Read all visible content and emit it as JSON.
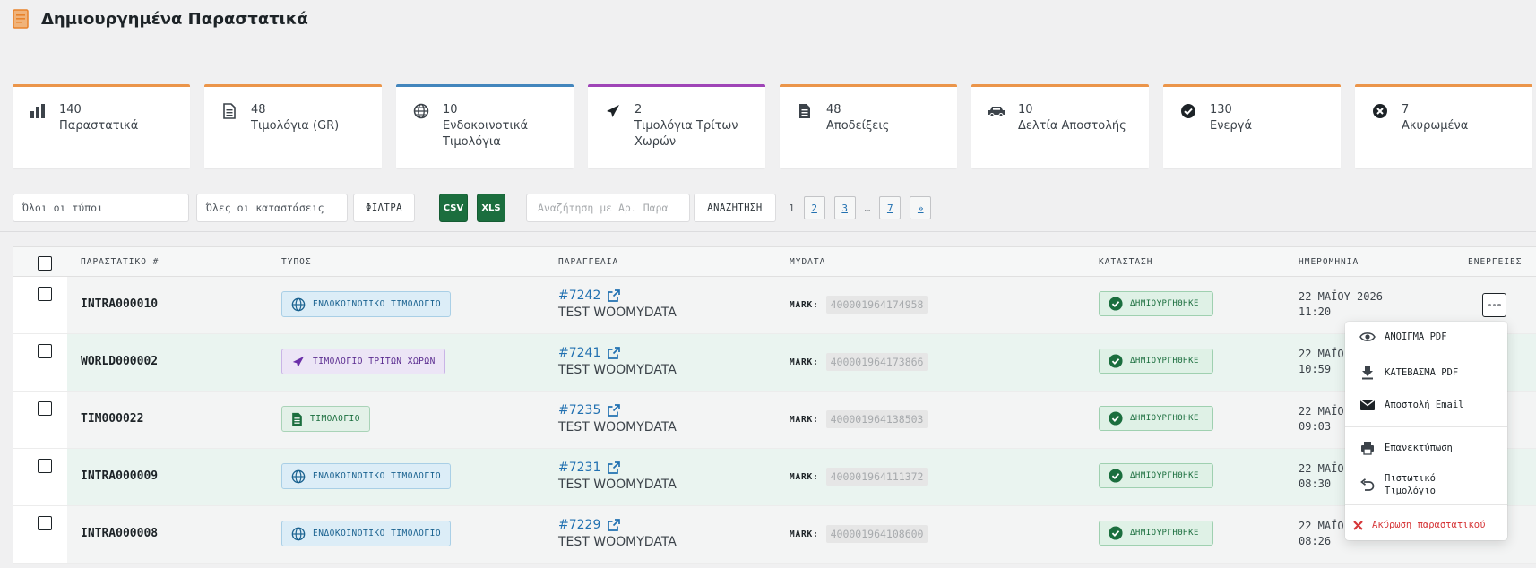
{
  "header": {
    "title": "Δημιουργημένα Παραστατικά",
    "icon": "document-icon"
  },
  "stats": [
    {
      "value": "140",
      "label": "Παραστατικά",
      "icon": "bar-chart-icon",
      "accent": "#e8822a"
    },
    {
      "value": "48",
      "label": "Τιμολόγια (GR)",
      "icon": "document-icon",
      "accent": "#e8822a"
    },
    {
      "value": "10",
      "label": "Ενδοκοινοτικά Τιμολόγια",
      "icon": "globe-icon",
      "accent": "#2271b1"
    },
    {
      "value": "2",
      "label": "Τιμολόγια Τρίτων Χωρών",
      "icon": "airplane-icon",
      "accent": "#8e24aa"
    },
    {
      "value": "48",
      "label": "Αποδείξεις",
      "icon": "receipt-icon",
      "accent": "#e8822a"
    },
    {
      "value": "10",
      "label": "Δελτία Αποστολής",
      "icon": "truck-icon",
      "accent": "#e8822a"
    },
    {
      "value": "130",
      "label": "Ενεργά",
      "icon": "check-circle-icon",
      "accent": "#e8822a"
    },
    {
      "value": "7",
      "label": "Ακυρωμένα",
      "icon": "x-circle-icon",
      "accent": "#e8822a"
    }
  ],
  "toolbar": {
    "type_filter": "Όλοι οι τύποι",
    "status_filter": "Όλες οι καταστάσεις",
    "filter_button": "ΦΙΛΤΡΑ",
    "csv_button": "CSV",
    "xls_button": "XLS",
    "search_placeholder": "Αναζήτηση με Αρ. Παρα",
    "search_button": "ΑΝΑΖΗΤΗΣΗ"
  },
  "pagination": {
    "current": "1",
    "pages": [
      "2",
      "3"
    ],
    "ellipsis": "…",
    "last": "7",
    "next": "»"
  },
  "table": {
    "columns": [
      "ΠΑΡΑΣΤΑΤΙΚΟ #",
      "ΤΥΠΟΣ",
      "ΠΑΡΑΓΓΕΛΙΑ",
      "MYDATA",
      "ΚΑΤΑΣΤΑΣΗ",
      "ΗΜΕΡΟΜΗΝΙΑ",
      "ΕΝΕΡΓΕΙΕΣ"
    ],
    "mark_label": "MARK:",
    "rows": [
      {
        "id": "INTRA000010",
        "type": "ΕΝΔΟΚΟΙΝΟΤΙΚΟ ΤΙΜΟΛΟΓΙΟ",
        "type_kind": "intra",
        "order": "#7242",
        "customer": "TEST WOOMYDATA",
        "mark": "400001964174958",
        "status": "ΔΗΜΙΟΥΡΓΗΘΗΚΕ",
        "date": "22 ΜΑΪΟΥ 2026",
        "time": "11:20"
      },
      {
        "id": "WORLD000002",
        "type": "ΤΙΜΟΛΟΓΙΟ ΤΡΙΤΩΝ ΧΩΡΩΝ",
        "type_kind": "world",
        "order": "#7241",
        "customer": "TEST WOOMYDATA",
        "mark": "400001964173866",
        "status": "ΔΗΜΙΟΥΡΓΗΘΗΚΕ",
        "date": "22 ΜΑΪΟ",
        "time": "10:59"
      },
      {
        "id": "TIM000022",
        "type": "ΤΙΜΟΛΟΓΙΟ",
        "type_kind": "tim",
        "order": "#7235",
        "customer": "TEST WOOMYDATA",
        "mark": "400001964138503",
        "status": "ΔΗΜΙΟΥΡΓΗΘΗΚΕ",
        "date": "22 ΜΑΪΟ",
        "time": "09:03"
      },
      {
        "id": "INTRA000009",
        "type": "ΕΝΔΟΚΟΙΝΟΤΙΚΟ ΤΙΜΟΛΟΓΙΟ",
        "type_kind": "intra",
        "order": "#7231",
        "customer": "TEST WOOMYDATA",
        "mark": "400001964111372",
        "status": "ΔΗΜΙΟΥΡΓΗΘΗΚΕ",
        "date": "22 ΜΑΪΟ",
        "time": "08:30"
      },
      {
        "id": "INTRA000008",
        "type": "ΕΝΔΟΚΟΙΝΟΤΙΚΟ ΤΙΜΟΛΟΓΙΟ",
        "type_kind": "intra",
        "order": "#7229",
        "customer": "TEST WOOMYDATA",
        "mark": "400001964108600",
        "status": "ΔΗΜΙΟΥΡΓΗΘΗΚΕ",
        "date": "22 ΜΑΪΟ",
        "time": "08:26"
      }
    ]
  },
  "actions_menu": {
    "open_pdf": "ΑΝΟΙΓΜΑ PDF",
    "download_pdf": "ΚΑΤΕΒΑΣΜΑ PDF",
    "send_email": "Αποστολή Email",
    "reprint": "Επανεκτύπωση",
    "credit_invoice": "Πιστωτικό Τιμολόγιο",
    "cancel": "Ακύρωση παραστατικού"
  },
  "colors": {
    "green": "#1b6e3e",
    "link": "#2271b1",
    "danger": "#d63638"
  }
}
